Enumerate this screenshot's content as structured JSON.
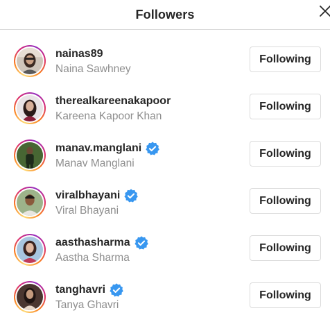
{
  "header": {
    "title": "Followers",
    "close_icon": "close-icon"
  },
  "followers": [
    {
      "username": "nainas89",
      "full_name": "Naina Sawhney",
      "verified": false,
      "button_label": "Following"
    },
    {
      "username": "therealkareenakapoor",
      "full_name": "Kareena Kapoor Khan",
      "verified": false,
      "button_label": "Following"
    },
    {
      "username": "manav.manglani",
      "full_name": "Manav Manglani",
      "verified": true,
      "button_label": "Following"
    },
    {
      "username": "viralbhayani",
      "full_name": "Viral Bhayani",
      "verified": true,
      "button_label": "Following"
    },
    {
      "username": "aasthasharma",
      "full_name": "Aastha Sharma",
      "verified": true,
      "button_label": "Following"
    },
    {
      "username": "tanghavri",
      "full_name": "Tanya Ghavri",
      "verified": true,
      "button_label": "Following"
    }
  ],
  "colors": {
    "verified_badge": "#3897f0",
    "secondary_text": "#8e8e8e",
    "primary_text": "#262626",
    "border": "#dbdbdb"
  }
}
